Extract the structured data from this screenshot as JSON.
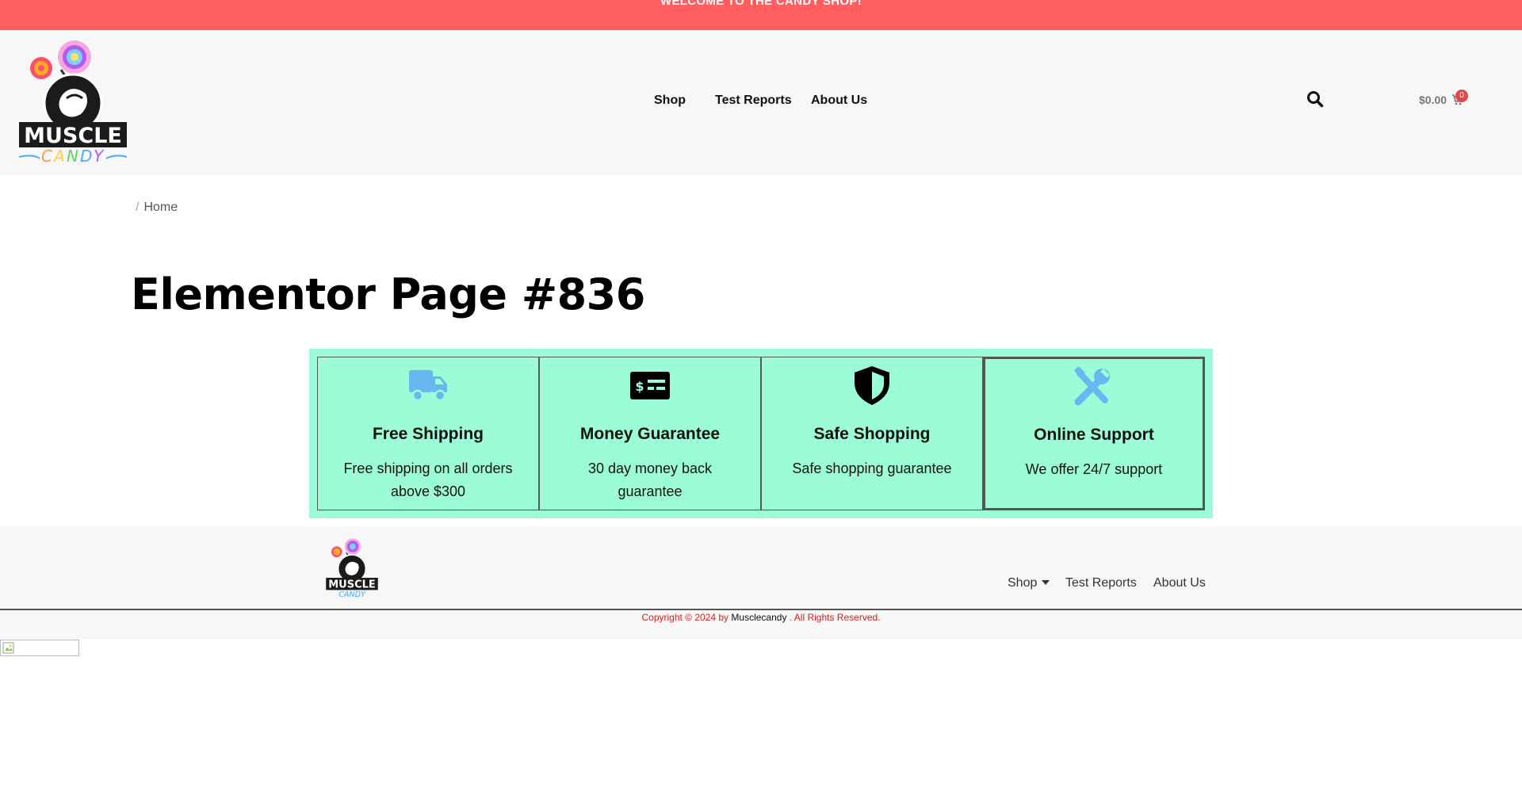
{
  "topbar": {
    "text": "WELCOME TO THE CANDY SHOP!"
  },
  "header": {
    "logo_alt": "MUSCLE CANDY",
    "nav": [
      {
        "label": "Shop"
      },
      {
        "label": "Test Reports"
      },
      {
        "label": "About Us"
      }
    ],
    "cart": {
      "total": "$0.00",
      "count": "0"
    }
  },
  "breadcrumb": {
    "separator": "/",
    "home": "Home"
  },
  "page": {
    "title": "Elementor Page #836"
  },
  "features": [
    {
      "icon": "truck-icon",
      "title": "Free Shipping",
      "desc": "Free shipping on all orders above $300"
    },
    {
      "icon": "money-bill-icon",
      "title": "Money Guarantee",
      "desc": "30 day money back guarantee"
    },
    {
      "icon": "shield-icon",
      "title": "Safe Shopping",
      "desc": "Safe shopping guarantee"
    },
    {
      "icon": "tools-icon",
      "title": "Online Support",
      "desc": "We offer 24/7 support"
    }
  ],
  "footer": {
    "nav": [
      {
        "label": "Shop"
      },
      {
        "label": "Test Reports"
      },
      {
        "label": "About Us"
      }
    ],
    "copyright_prefix": "Copyright © 2024 by",
    "copyright_brand": "Musclecandy",
    "copyright_suffix": ". All Rights Reserved."
  },
  "colors": {
    "topbar": "#ff5e5e",
    "features_bg": "#9dfcd8",
    "icon_blue": "#6ab6ee",
    "copyright_red": "#d81e1e"
  }
}
